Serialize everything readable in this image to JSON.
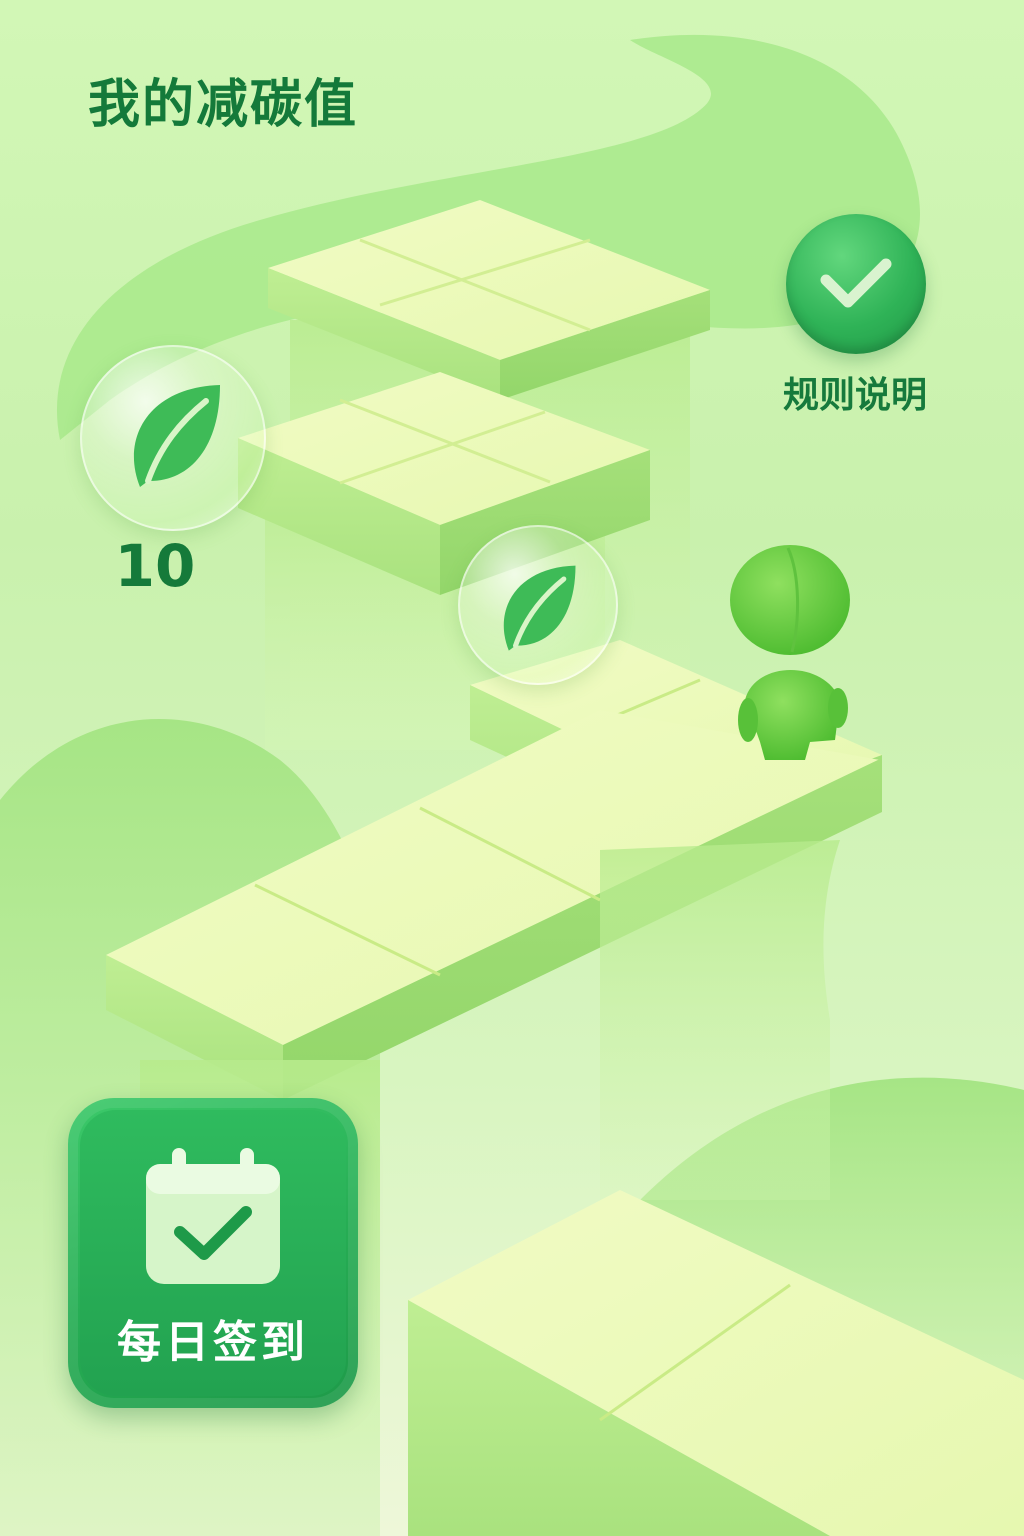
{
  "header": {
    "title": "我的减碳值"
  },
  "rules": {
    "label": "规则说明",
    "icon": "check-icon"
  },
  "score": {
    "value": "10",
    "icon": "leaf-icon"
  },
  "checkin": {
    "label": "每日签到",
    "icon": "calendar-check-icon"
  },
  "colors": {
    "accent": "#147a3a",
    "button_green": "#2fb357",
    "background": "#d2f7b6"
  }
}
